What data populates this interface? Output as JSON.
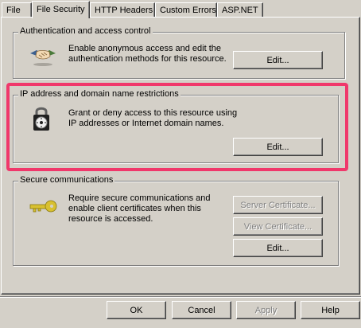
{
  "tabs": [
    {
      "label": "File"
    },
    {
      "label": "File Security"
    },
    {
      "label": "HTTP Headers"
    },
    {
      "label": "Custom Errors"
    },
    {
      "label": "ASP.NET"
    }
  ],
  "active_tab": "File Security",
  "auth": {
    "title": "Authentication and access control",
    "description": "Enable anonymous access and edit the authentication methods for this resource.",
    "edit_label": "Edit..."
  },
  "ip": {
    "title": "IP address and domain name restrictions",
    "description": "Grant or deny access to this resource using IP addresses or Internet domain names.",
    "edit_label": "Edit..."
  },
  "secure": {
    "title": "Secure communications",
    "description": "Require secure communications and enable client certificates when this resource is accessed.",
    "server_cert_label": "Server Certificate...",
    "view_cert_label": "View Certificate...",
    "edit_label": "Edit..."
  },
  "footer": {
    "ok_label": "OK",
    "cancel_label": "Cancel",
    "apply_label": "Apply",
    "help_label": "Help"
  },
  "colors": {
    "dialog_background": "#d4d0c8",
    "highlight": "#f0386b"
  },
  "icons": [
    "handshake-icon",
    "padlock-icon",
    "key-icon"
  ]
}
